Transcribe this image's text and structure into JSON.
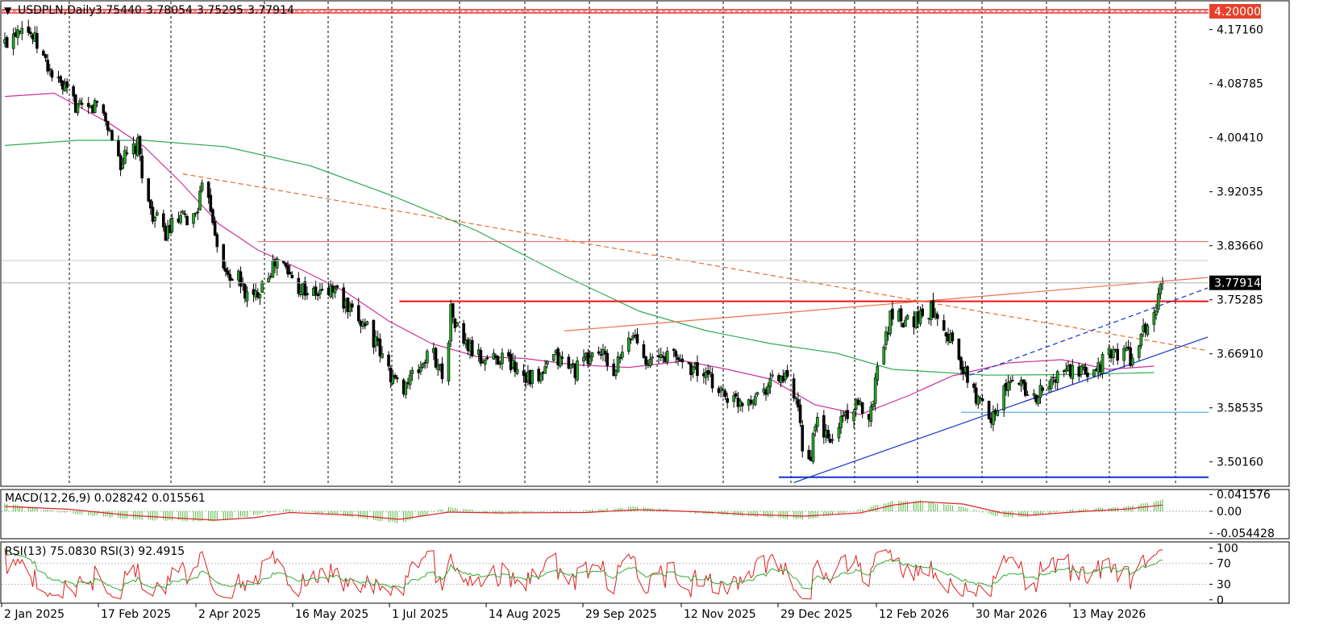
{
  "chart_data": {
    "type": "candlestick",
    "symbol": "USDPLN,Daily",
    "header_values": [
      "3.75440",
      "3.78054",
      "3.75295",
      "3.77914"
    ],
    "price_axis": {
      "ticks": [
        "4.17160",
        "4.08785",
        "4.00410",
        "3.92035",
        "3.83660",
        "3.75285",
        "3.66910",
        "3.58535",
        "3.50160"
      ],
      "tick_values": [
        4.1716,
        4.08785,
        4.0041,
        3.92035,
        3.8366,
        3.75285,
        3.6691,
        3.58535,
        3.5016
      ],
      "range": [
        3.465,
        4.215
      ]
    },
    "current_price_label": "3.77914",
    "current_price": 3.77914,
    "level_label": "4.20000",
    "level_value": 4.2,
    "date_axis": [
      "2 Jan 2025",
      "17 Feb 2025",
      "2 Apr 2025",
      "16 May 2025",
      "1 Jul 2025",
      "14 Aug 2025",
      "29 Sep 2025",
      "12 Nov 2025",
      "29 Dec 2025",
      "12 Feb 2026",
      "30 Mar 2026",
      "13 May 2026"
    ],
    "date_range": [
      "2025-01-02",
      "2026-06-26"
    ],
    "horizontal_levels": [
      {
        "value": 4.2,
        "color": "#e03030",
        "style": "double"
      },
      {
        "value": 3.843,
        "color": "#e06060",
        "style": "thin",
        "from": "2025-04-30"
      },
      {
        "value": 3.7505,
        "color": "#ee1111",
        "style": "thick",
        "from": "2025-07-05"
      },
      {
        "value": 3.5785,
        "color": "#3399dd",
        "style": "thin",
        "from": "2026-03-24"
      },
      {
        "value": 3.4778,
        "color": "#1133cc",
        "style": "thick",
        "from": "2025-12-29"
      }
    ],
    "trendlines": [
      {
        "from": [
          "2025-03-26",
          3.948
        ],
        "to": [
          "2026-06-26",
          3.686
        ],
        "color": "#e07030",
        "style": "dash"
      },
      {
        "from": [
          "2025-09-20",
          3.7045
        ],
        "to": [
          "2026-06-26",
          3.7815
        ],
        "color": "#f07050",
        "style": "solid"
      },
      {
        "from": [
          "2026-01-05",
          3.4695
        ],
        "to": [
          "2026-06-26",
          3.6705
        ],
        "color": "#1133cc",
        "style": "solid"
      },
      {
        "from": [
          "2026-03-28",
          3.636
        ],
        "to": [
          "2026-06-26",
          3.7455
        ],
        "color": "#1133cc",
        "style": "dash"
      }
    ],
    "ma_fast": [
      [
        "2025-01-02",
        4.068
      ],
      [
        "2025-01-25",
        4.073
      ],
      [
        "2025-02-20",
        4.026
      ],
      [
        "2025-03-08",
        3.99
      ],
      [
        "2025-03-25",
        3.935
      ],
      [
        "2025-04-12",
        3.87
      ],
      [
        "2025-04-30",
        3.83
      ],
      [
        "2025-05-20",
        3.8
      ],
      [
        "2025-06-10",
        3.765
      ],
      [
        "2025-06-30",
        3.72
      ],
      [
        "2025-07-20",
        3.685
      ],
      [
        "2025-08-10",
        3.665
      ],
      [
        "2025-09-01",
        3.662
      ],
      [
        "2025-09-25",
        3.652
      ],
      [
        "2025-10-20",
        3.648
      ],
      [
        "2025-11-15",
        3.658
      ],
      [
        "2025-12-05",
        3.645
      ],
      [
        "2025-12-25",
        3.63
      ],
      [
        "2026-01-15",
        3.59
      ],
      [
        "2026-02-05",
        3.575
      ],
      [
        "2026-02-28",
        3.605
      ],
      [
        "2026-03-20",
        3.635
      ],
      [
        "2026-04-15",
        3.655
      ],
      [
        "2026-05-10",
        3.66
      ],
      [
        "2026-06-01",
        3.645
      ],
      [
        "2026-06-22",
        3.65
      ]
    ],
    "ma_slow": [
      [
        "2025-01-02",
        3.992
      ],
      [
        "2025-02-05",
        4.0
      ],
      [
        "2025-03-08",
        4.0
      ],
      [
        "2025-04-15",
        3.99
      ],
      [
        "2025-05-25",
        3.96
      ],
      [
        "2025-07-01",
        3.915
      ],
      [
        "2025-08-10",
        3.86
      ],
      [
        "2025-09-20",
        3.79
      ],
      [
        "2025-10-25",
        3.735
      ],
      [
        "2025-11-25",
        3.705
      ],
      [
        "2025-12-25",
        3.685
      ],
      [
        "2026-01-25",
        3.67
      ],
      [
        "2026-02-20",
        3.645
      ],
      [
        "2026-04-05",
        3.636
      ],
      [
        "2026-05-15",
        3.637
      ],
      [
        "2026-06-22",
        3.64
      ]
    ],
    "price_path": [
      [
        "2025-01-02",
        4.15
      ],
      [
        "2025-01-10",
        4.185
      ],
      [
        "2025-01-15",
        4.16
      ],
      [
        "2025-01-25",
        4.095
      ],
      [
        "2025-02-08",
        4.04
      ],
      [
        "2025-02-15",
        4.06
      ],
      [
        "2025-02-25",
        3.965
      ],
      [
        "2025-03-05",
        3.99
      ],
      [
        "2025-03-10",
        3.9
      ],
      [
        "2025-03-17",
        3.855
      ],
      [
        "2025-03-24",
        3.875
      ],
      [
        "2025-03-31",
        3.88
      ],
      [
        "2025-04-06",
        3.94
      ],
      [
        "2025-04-09",
        3.88
      ],
      [
        "2025-04-14",
        3.795
      ],
      [
        "2025-04-21",
        3.785
      ],
      [
        "2025-04-27",
        3.745
      ],
      [
        "2025-05-03",
        3.79
      ],
      [
        "2025-05-10",
        3.815
      ],
      [
        "2025-05-17",
        3.78
      ],
      [
        "2025-05-26",
        3.76
      ],
      [
        "2025-06-05",
        3.77
      ],
      [
        "2025-06-12",
        3.73
      ],
      [
        "2025-06-20",
        3.715
      ],
      [
        "2025-06-28",
        3.655
      ],
      [
        "2025-07-05",
        3.615
      ],
      [
        "2025-07-12",
        3.635
      ],
      [
        "2025-07-20",
        3.675
      ],
      [
        "2025-07-26",
        3.63
      ],
      [
        "2025-07-29",
        3.735
      ],
      [
        "2025-08-03",
        3.69
      ],
      [
        "2025-08-12",
        3.66
      ],
      [
        "2025-08-22",
        3.665
      ],
      [
        "2025-09-01",
        3.64
      ],
      [
        "2025-09-08",
        3.625
      ],
      [
        "2025-09-15",
        3.665
      ],
      [
        "2025-09-25",
        3.645
      ],
      [
        "2025-10-06",
        3.675
      ],
      [
        "2025-10-13",
        3.64
      ],
      [
        "2025-10-22",
        3.7
      ],
      [
        "2025-10-30",
        3.655
      ],
      [
        "2025-11-08",
        3.67
      ],
      [
        "2025-11-18",
        3.65
      ],
      [
        "2025-11-28",
        3.625
      ],
      [
        "2025-12-08",
        3.595
      ],
      [
        "2025-12-18",
        3.605
      ],
      [
        "2025-12-28",
        3.635
      ],
      [
        "2026-01-03",
        3.625
      ],
      [
        "2026-01-07",
        3.575
      ],
      [
        "2026-01-11",
        3.485
      ],
      [
        "2026-01-16",
        3.565
      ],
      [
        "2026-01-22",
        3.53
      ],
      [
        "2026-01-28",
        3.575
      ],
      [
        "2026-02-03",
        3.585
      ],
      [
        "2026-02-10",
        3.58
      ],
      [
        "2026-02-14",
        3.67
      ],
      [
        "2026-02-20",
        3.735
      ],
      [
        "2026-02-27",
        3.72
      ],
      [
        "2026-03-06",
        3.73
      ],
      [
        "2026-03-12",
        3.74
      ],
      [
        "2026-03-20",
        3.685
      ],
      [
        "2026-03-26",
        3.635
      ],
      [
        "2026-04-01",
        3.595
      ],
      [
        "2026-04-07",
        3.575
      ],
      [
        "2026-04-15",
        3.62
      ],
      [
        "2026-04-21",
        3.625
      ],
      [
        "2026-04-27",
        3.6
      ],
      [
        "2026-05-04",
        3.62
      ],
      [
        "2026-05-11",
        3.645
      ],
      [
        "2026-05-18",
        3.635
      ],
      [
        "2026-05-25",
        3.645
      ],
      [
        "2026-06-01",
        3.665
      ],
      [
        "2026-06-08",
        3.675
      ],
      [
        "2026-06-12",
        3.66
      ],
      [
        "2026-06-17",
        3.7
      ],
      [
        "2026-06-23",
        3.74
      ],
      [
        "2026-06-26",
        3.779
      ]
    ],
    "macd": {
      "label": "MACD(12,26,9)",
      "values_text": "0.028242 0.015561",
      "ticks": [
        "0.041576",
        "0.00",
        "-0.054428"
      ],
      "tick_values": [
        0.041576,
        0.0,
        -0.054428
      ],
      "range": [
        -0.066,
        0.052
      ],
      "signal": [
        [
          "2025-01-02",
          0.012
        ],
        [
          "2025-02-01",
          0.005
        ],
        [
          "2025-03-01",
          -0.01
        ],
        [
          "2025-04-10",
          -0.022
        ],
        [
          "2025-04-28",
          -0.016
        ],
        [
          "2025-05-15",
          -0.003
        ],
        [
          "2025-06-15",
          -0.01
        ],
        [
          "2025-07-05",
          -0.02
        ],
        [
          "2025-07-28",
          -0.002
        ],
        [
          "2025-08-20",
          -0.004
        ],
        [
          "2025-09-30",
          -0.003
        ],
        [
          "2025-10-25",
          0.004
        ],
        [
          "2025-11-20",
          -0.001
        ],
        [
          "2025-12-15",
          -0.008
        ],
        [
          "2026-01-10",
          -0.012
        ],
        [
          "2026-02-05",
          -0.004
        ],
        [
          "2026-02-20",
          0.015
        ],
        [
          "2026-03-05",
          0.024
        ],
        [
          "2026-03-25",
          0.018
        ],
        [
          "2026-04-12",
          -0.004
        ],
        [
          "2026-04-25",
          -0.01
        ],
        [
          "2026-05-15",
          -0.002
        ],
        [
          "2026-06-10",
          0.006
        ],
        [
          "2026-06-26",
          0.015561
        ]
      ],
      "histogram": [
        [
          "2025-01-02",
          0.02
        ],
        [
          "2025-02-01",
          -0.005
        ],
        [
          "2025-03-01",
          -0.02
        ],
        [
          "2025-04-10",
          -0.025
        ],
        [
          "2025-04-28",
          -0.01
        ],
        [
          "2025-05-15",
          0.005
        ],
        [
          "2025-06-15",
          -0.015
        ],
        [
          "2025-07-05",
          -0.03
        ],
        [
          "2025-07-28",
          0.01
        ],
        [
          "2025-08-20",
          -0.006
        ],
        [
          "2025-09-30",
          0.002
        ],
        [
          "2025-10-25",
          0.012
        ],
        [
          "2025-11-20",
          -0.004
        ],
        [
          "2025-12-15",
          -0.012
        ],
        [
          "2026-01-10",
          -0.02
        ],
        [
          "2026-02-05",
          0.004
        ],
        [
          "2026-02-20",
          0.025
        ],
        [
          "2026-03-05",
          0.026
        ],
        [
          "2026-03-25",
          0.01
        ],
        [
          "2026-04-12",
          -0.015
        ],
        [
          "2026-04-25",
          -0.014
        ],
        [
          "2026-05-15",
          0.004
        ],
        [
          "2026-06-10",
          0.012
        ],
        [
          "2026-06-26",
          0.028242
        ]
      ]
    },
    "rsi": {
      "label": "RSI(13) 75.0830 RSI(3) 92.4915",
      "ticks": [
        "100",
        "70",
        "30",
        "0"
      ],
      "tick_values": [
        100,
        70,
        30,
        0
      ],
      "range": [
        -5,
        110
      ]
    }
  }
}
